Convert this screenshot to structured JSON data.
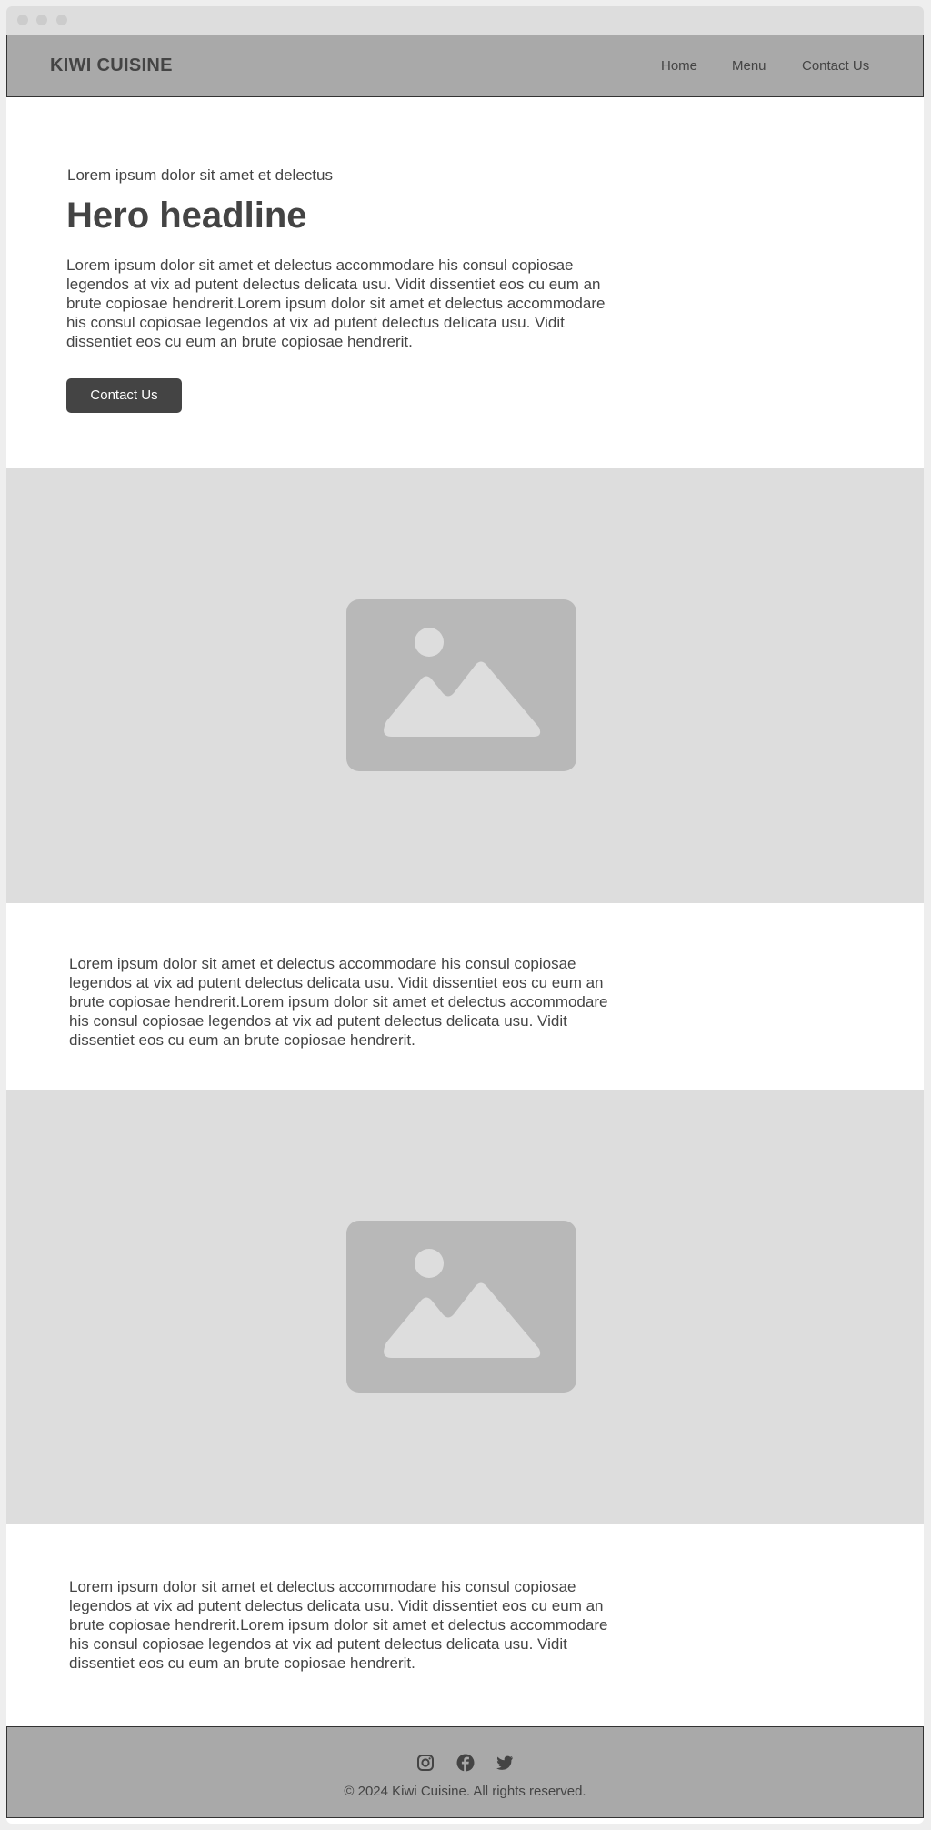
{
  "nav": {
    "brand": "KIWI CUISINE",
    "links": [
      "Home",
      "Menu",
      "Contact Us"
    ]
  },
  "hero": {
    "eyebrow": "Lorem ipsum dolor sit amet et delectus",
    "headline": "Hero headline",
    "body": "Lorem ipsum dolor sit amet et delectus accommodare his consul copiosae legendos at vix ad putent delectus delicata usu. Vidit dissentiet eos cu eum an brute copiosae hendrerit.Lorem ipsum dolor sit amet et delectus accommodare his consul copiosae legendos at vix ad putent delectus delicata usu. Vidit dissentiet eos cu eum an brute copiosae hendrerit.",
    "cta_label": "Contact Us"
  },
  "sections": [
    {
      "body": "Lorem ipsum dolor sit amet et delectus accommodare his consul copiosae legendos at vix ad putent delectus delicata usu. Vidit dissentiet eos cu eum an brute copiosae hendrerit.Lorem ipsum dolor sit amet et delectus accommodare his consul copiosae legendos at vix ad putent delectus delicata usu. Vidit dissentiet eos cu eum an brute copiosae hendrerit."
    },
    {
      "body": "Lorem ipsum dolor sit amet et delectus accommodare his consul copiosae legendos at vix ad putent delectus delicata usu. Vidit dissentiet eos cu eum an brute copiosae hendrerit.Lorem ipsum dolor sit amet et delectus accommodare his consul copiosae legendos at vix ad putent delectus delicata usu. Vidit dissentiet eos cu eum an brute copiosae hendrerit."
    }
  ],
  "images": [
    {
      "icon": "image-placeholder-icon"
    },
    {
      "icon": "image-placeholder-icon"
    }
  ],
  "footer": {
    "social_icons": [
      "instagram-icon",
      "facebook-icon",
      "twitter-icon"
    ],
    "copyright": "© 2024 Kiwi Cuisine. All rights reserved."
  },
  "colors": {
    "nav_bg": "#a9a9a9",
    "text": "#444444",
    "button_bg": "#444444",
    "image_bg": "#dddddd",
    "placeholder": "#b8b8b8"
  }
}
